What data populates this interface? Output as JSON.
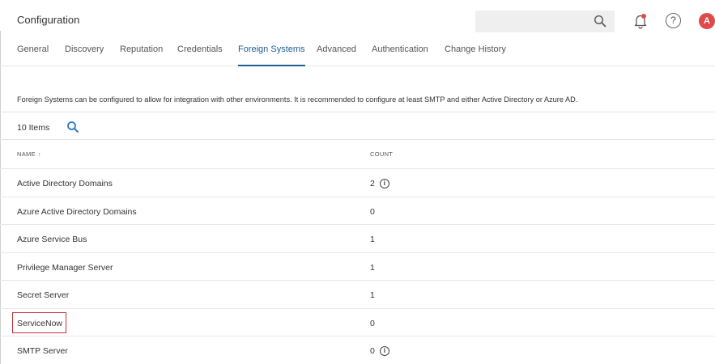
{
  "header": {
    "title": "Configuration",
    "search_placeholder": "",
    "avatar_initial": "A",
    "help_glyph": "?"
  },
  "tabs": [
    {
      "label": "General"
    },
    {
      "label": "Discovery"
    },
    {
      "label": "Reputation"
    },
    {
      "label": "Credentials"
    },
    {
      "label": "Foreign Systems",
      "active": true
    },
    {
      "label": "Advanced"
    },
    {
      "label": "Authentication"
    },
    {
      "label": "Change History"
    }
  ],
  "description": "Foreign Systems can be configured to allow for integration with other environments. It is recommended to configure at least SMTP and either Active Directory or Azure AD.",
  "list": {
    "items_count": "10 Items",
    "columns": {
      "name": "NAME",
      "count": "COUNT"
    },
    "rows": [
      {
        "name": "Active Directory Domains",
        "count": "2",
        "info": true
      },
      {
        "name": "Azure Active Directory Domains",
        "count": "0",
        "info": false
      },
      {
        "name": "Azure Service Bus",
        "count": "1",
        "info": false
      },
      {
        "name": "Privilege Manager Server",
        "count": "1",
        "info": false
      },
      {
        "name": "Secret Server",
        "count": "1",
        "info": false
      },
      {
        "name": "ServiceNow",
        "count": "0",
        "info": false
      },
      {
        "name": "SMTP Server",
        "count": "0",
        "info": true
      }
    ]
  },
  "colors": {
    "accent": "#1f5f91",
    "highlight_border": "#c4343c",
    "avatar_bg": "#e04a4a",
    "search_icon": "#2b7cc0"
  },
  "icons": [
    "search-icon",
    "bell-icon",
    "help-icon",
    "sort-asc-icon",
    "info-icon"
  ]
}
